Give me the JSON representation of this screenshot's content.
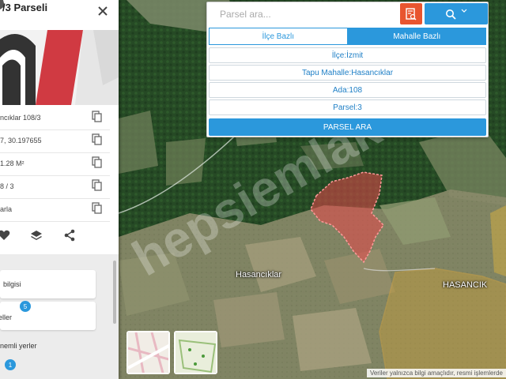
{
  "side_panel": {
    "title": "/3 Parseli",
    "rows": [
      {
        "text": "ncıklar 108/3"
      },
      {
        "text": "7, 30.197655"
      },
      {
        "text": "1.28 M²"
      },
      {
        "text": "8 / 3"
      },
      {
        "text": "arla"
      }
    ],
    "cards": [
      {
        "label": "bilgisi"
      },
      {
        "label": "eller",
        "badge": "5"
      }
    ],
    "nearby_label": "nemli yerler",
    "nearby_badge": "1"
  },
  "search": {
    "placeholder": "Parsel ara...",
    "tabs": [
      {
        "label": "İlçe Bazlı",
        "active": false
      },
      {
        "label": "Mahalle Bazlı",
        "active": true
      }
    ],
    "fields": [
      {
        "text": "İlçe:İzmit"
      },
      {
        "text": "Tapu Mahalle:Hasancıklar"
      },
      {
        "text": "Ada:108"
      },
      {
        "text": "Parsel:3"
      }
    ],
    "submit_label": "PARSEL ARA"
  },
  "map": {
    "place_labels": [
      "Hasancıklar",
      "HASANCIK"
    ],
    "watermark": "hepsiemlak",
    "disclaimer": "Veriler yalnızca bilgi amaçlıdır, resmi işlemlerde",
    "parcel_color": "#e8474a",
    "accent_blue": "#2b98dc",
    "accent_orange": "#e8552f"
  }
}
